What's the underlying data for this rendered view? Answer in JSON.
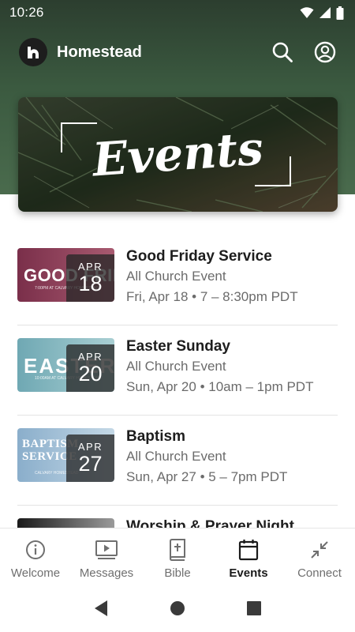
{
  "status": {
    "time": "10:26"
  },
  "app": {
    "title": "Homestead"
  },
  "banner": {
    "text": "Events"
  },
  "events": [
    {
      "thumb_title": "GOOD FRIDAY",
      "thumb_sub": "7:00PM AT CALVARY HOMESTEAD",
      "thumb_colors": [
        "#7a2f4a",
        "#a85a70"
      ],
      "month": "APR",
      "day": "18",
      "title": "Good Friday Service",
      "type": "All Church Event",
      "time": "Fri, Apr 18 • 7 – 8:30pm PDT"
    },
    {
      "thumb_title": "EASTER",
      "thumb_sub": "10:00AM AT CALVARY HOMESTEAD",
      "thumb_colors": [
        "#6fa8b3",
        "#a9cfd3"
      ],
      "month": "APR",
      "day": "20",
      "title": "Easter Sunday",
      "type": "All Church Event",
      "time": "Sun, Apr 20 • 10am – 1pm PDT"
    },
    {
      "thumb_title": "BAPTISM SERVICE",
      "thumb_sub": "CALVARY HOMESTEAD",
      "thumb_colors": [
        "#8aaecb",
        "#c4d8e6"
      ],
      "month": "APR",
      "day": "27",
      "title": "Baptism",
      "type": "All Church Event",
      "time": "Sun, Apr 27 • 5 – 7pm PDT"
    },
    {
      "thumb_title": "",
      "thumb_sub": "",
      "thumb_colors": [
        "#1a1a1a",
        "#9a9a9a"
      ],
      "month": "",
      "day": "",
      "title": "Worship & Prayer Night",
      "type": "",
      "time": ""
    }
  ],
  "nav": [
    {
      "label": "Welcome",
      "icon": "info-circle-icon",
      "active": false
    },
    {
      "label": "Messages",
      "icon": "play-video-icon",
      "active": false
    },
    {
      "label": "Bible",
      "icon": "bible-book-icon",
      "active": false
    },
    {
      "label": "Events",
      "icon": "calendar-icon",
      "active": true
    },
    {
      "label": "Connect",
      "icon": "arrows-in-icon",
      "active": false
    }
  ]
}
